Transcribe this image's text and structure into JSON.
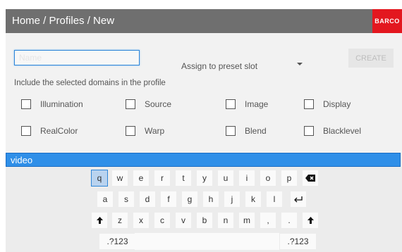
{
  "header": {
    "breadcrumb": "Home / Profiles / New",
    "brand": "BARCO",
    "brand_color": "#e3171f",
    "header_color": "#6f6f6f"
  },
  "form": {
    "name_input": {
      "value": "",
      "placeholder": "Name"
    },
    "preset_select": {
      "label": "Assign to preset slot"
    },
    "create_label": "CREATE",
    "domains_label": "Include the selected domains in the profile",
    "domains": [
      {
        "label": "Illumination",
        "checked": false
      },
      {
        "label": "Source",
        "checked": false
      },
      {
        "label": "Image",
        "checked": false
      },
      {
        "label": "Display",
        "checked": false
      },
      {
        "label": "RealColor",
        "checked": false
      },
      {
        "label": "Warp",
        "checked": false
      },
      {
        "label": "Blend",
        "checked": false
      },
      {
        "label": "Blacklevel",
        "checked": false
      }
    ]
  },
  "keyboard": {
    "input_value": "video",
    "accent_color": "#2f8fe8",
    "row1": [
      "q",
      "w",
      "e",
      "r",
      "t",
      "y",
      "u",
      "i",
      "o",
      "p"
    ],
    "row2": [
      "a",
      "s",
      "d",
      "f",
      "g",
      "h",
      "j",
      "k",
      "l"
    ],
    "row3": [
      "z",
      "x",
      "c",
      "v",
      "b",
      "n",
      "m",
      ",",
      "."
    ],
    "backspace_icon": "backspace-icon",
    "enter_icon": "enter-icon",
    "shift_icon": "shift-icon",
    "symbols_label": ".?123",
    "active_key": "q"
  }
}
